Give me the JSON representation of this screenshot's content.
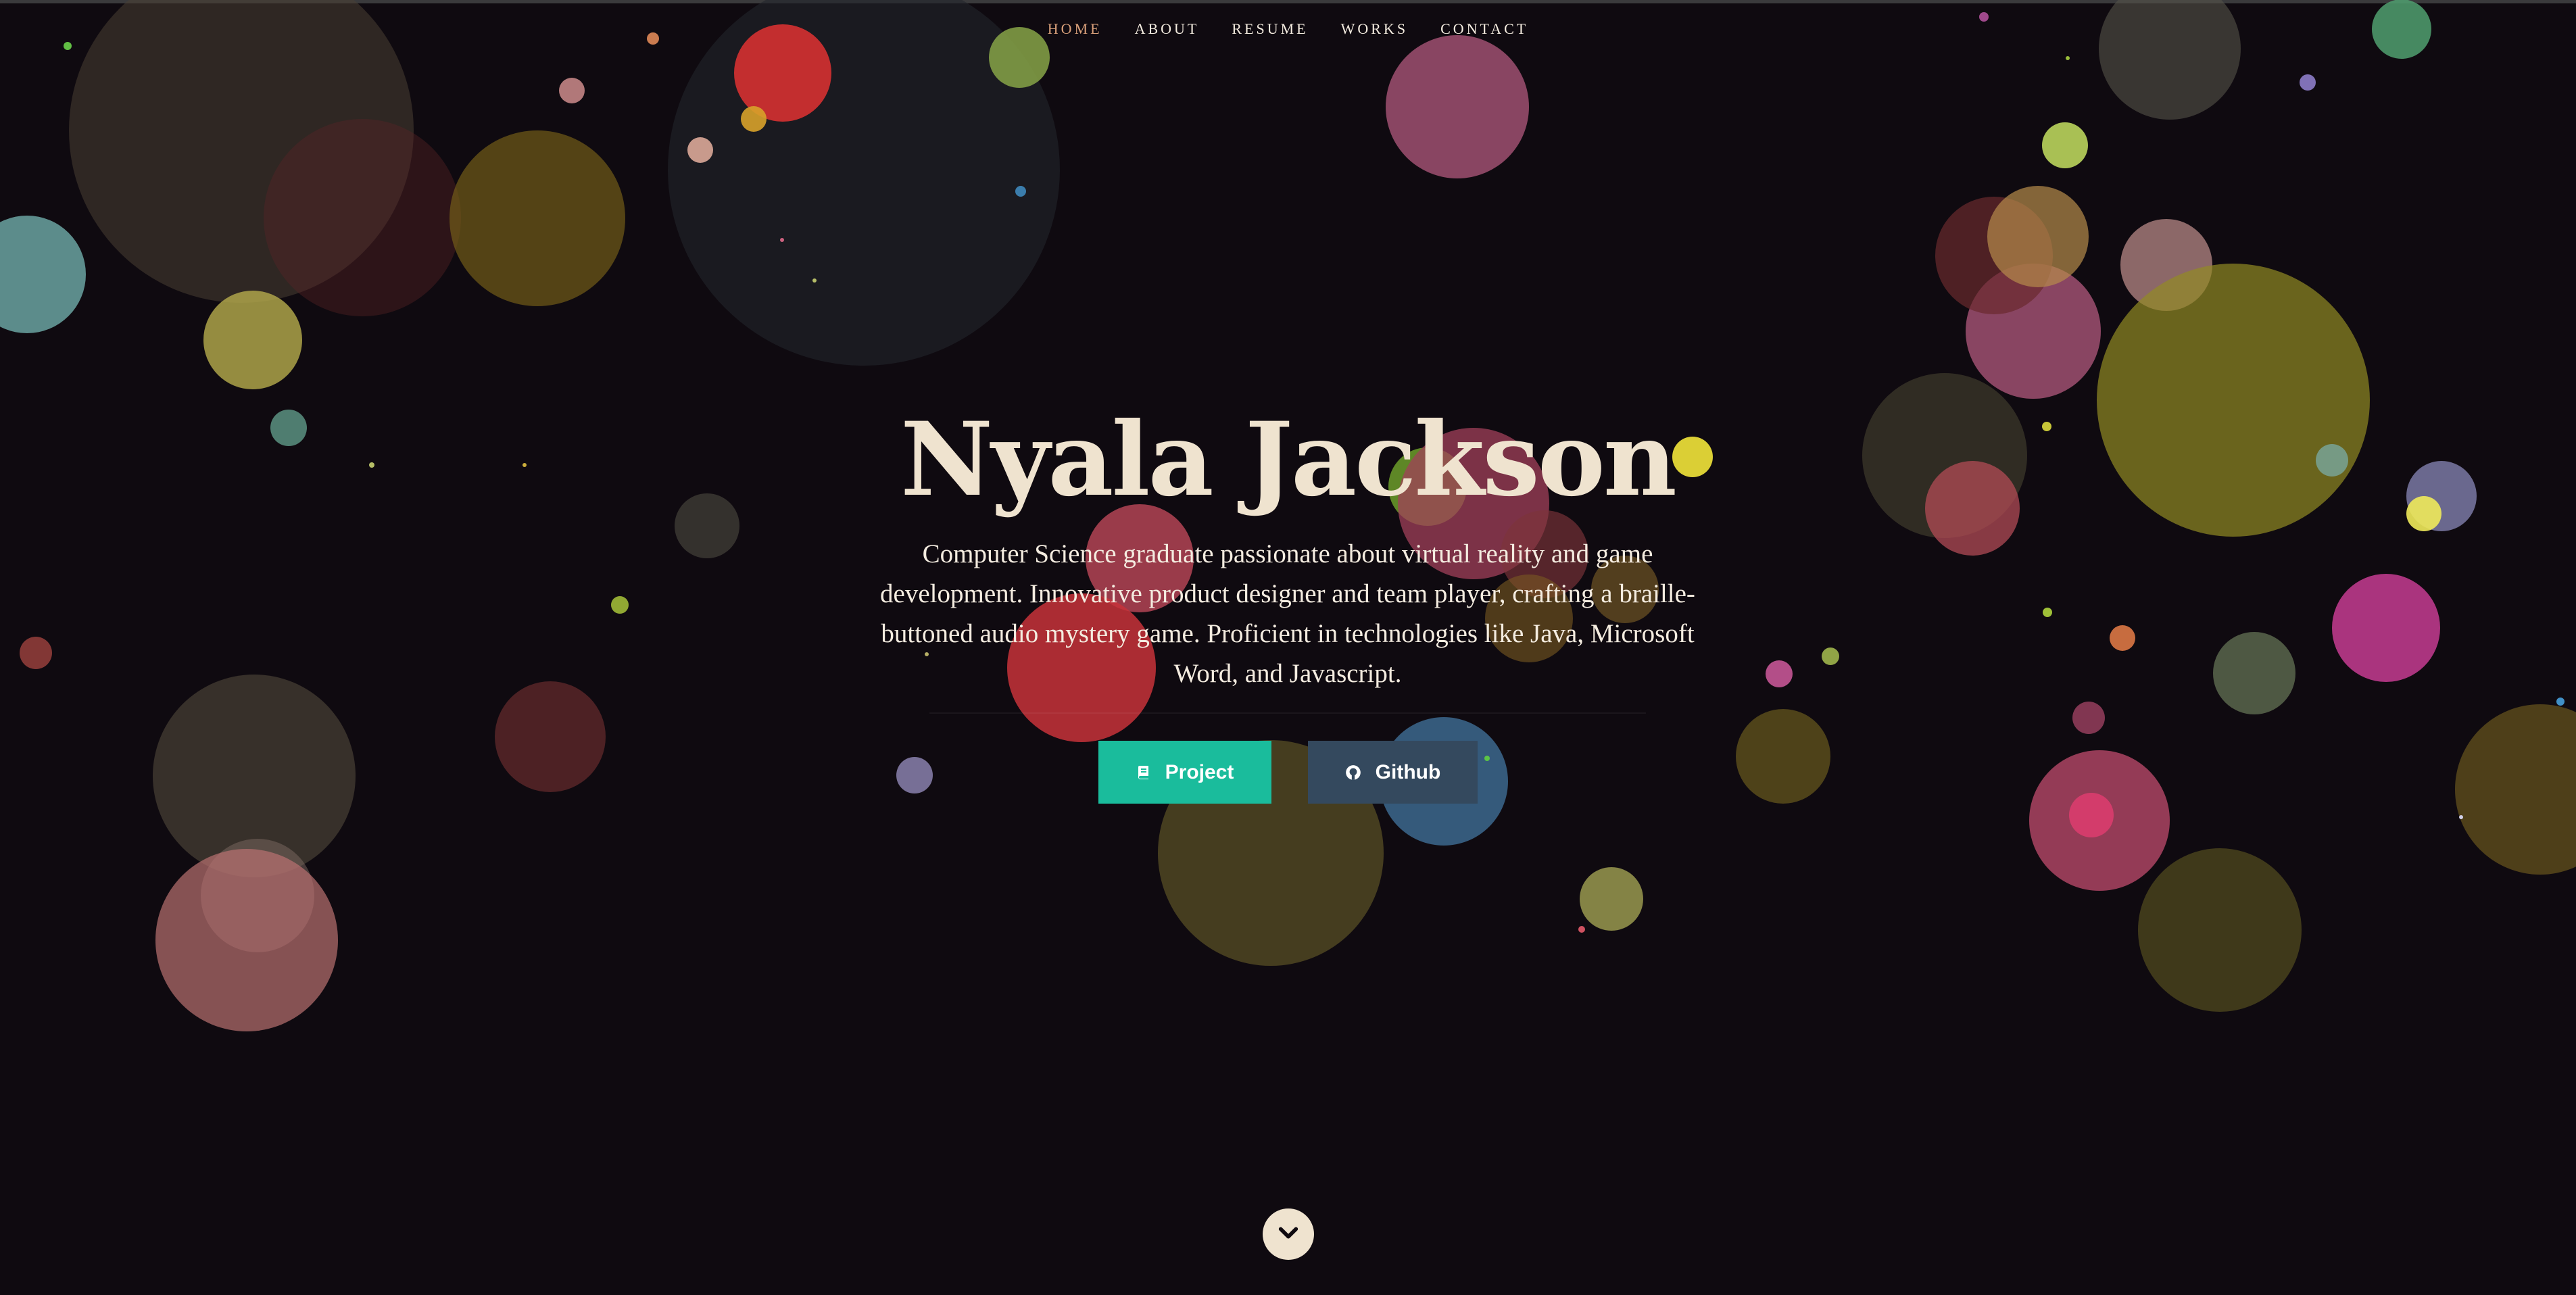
{
  "nav": {
    "items": [
      {
        "label": "HOME",
        "active": true
      },
      {
        "label": "ABOUT",
        "active": false
      },
      {
        "label": "RESUME",
        "active": false
      },
      {
        "label": "WORKS",
        "active": false
      },
      {
        "label": "CONTACT",
        "active": false
      }
    ]
  },
  "hero": {
    "name": "Nyala Jackson",
    "bio": "Computer Science graduate passionate about virtual reality and game development. Innovative product designer and team player, crafting a braille-buttoned audio mystery game. Proficient in technologies like Java, Microsoft Word, and Javascript.",
    "buttons": {
      "project": {
        "label": "Project",
        "icon": "book-icon"
      },
      "github": {
        "label": "Github",
        "icon": "github-icon"
      }
    }
  },
  "scroll": {
    "icon": "chevron-down-icon"
  },
  "colors": {
    "background": "#0f0a10",
    "heading": "#efe3cf",
    "nav_active": "#d9a07a",
    "project_button": "#1abc9c",
    "github_button": "#34495e"
  }
}
